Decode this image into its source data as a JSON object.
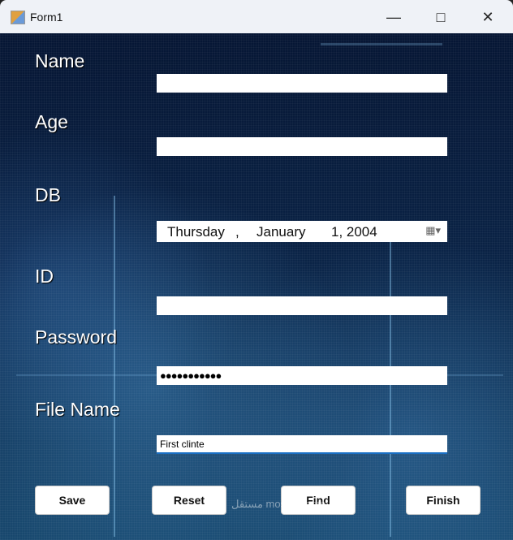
{
  "window": {
    "title": "Form1"
  },
  "form": {
    "labels": {
      "name": "Name",
      "age": "Age",
      "db": "DB",
      "id": "ID",
      "password": "Password",
      "file_name": "File Name"
    },
    "values": {
      "name": "",
      "age": "",
      "id": "",
      "password": "●●●●●●●●●●●",
      "file_name": "First clinte"
    },
    "date": {
      "weekday": "Thursday",
      "sep": ",",
      "month": "January",
      "day_year": "1, 2004"
    }
  },
  "buttons": {
    "save": "Save",
    "reset": "Reset",
    "find": "Find",
    "finish": "Finish"
  },
  "watermark": "مستقل mostaql.com"
}
